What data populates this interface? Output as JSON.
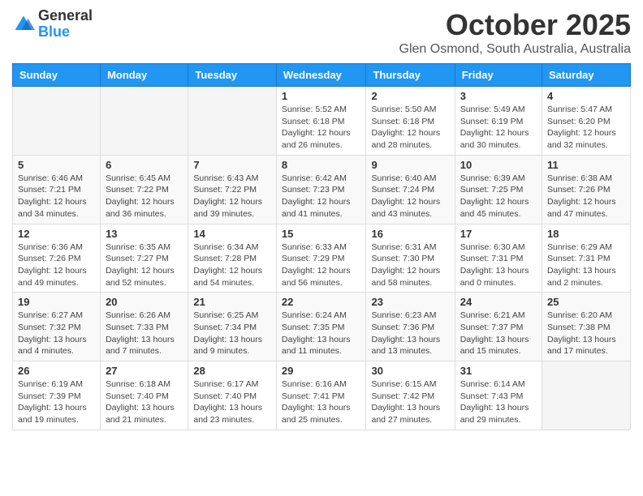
{
  "logo": {
    "general": "General",
    "blue": "Blue"
  },
  "header": {
    "month": "October 2025",
    "location": "Glen Osmond, South Australia, Australia"
  },
  "days_of_week": [
    "Sunday",
    "Monday",
    "Tuesday",
    "Wednesday",
    "Thursday",
    "Friday",
    "Saturday"
  ],
  "weeks": [
    [
      {
        "day": "",
        "info": ""
      },
      {
        "day": "",
        "info": ""
      },
      {
        "day": "",
        "info": ""
      },
      {
        "day": "1",
        "info": "Sunrise: 5:52 AM\nSunset: 6:18 PM\nDaylight: 12 hours\nand 26 minutes."
      },
      {
        "day": "2",
        "info": "Sunrise: 5:50 AM\nSunset: 6:18 PM\nDaylight: 12 hours\nand 28 minutes."
      },
      {
        "day": "3",
        "info": "Sunrise: 5:49 AM\nSunset: 6:19 PM\nDaylight: 12 hours\nand 30 minutes."
      },
      {
        "day": "4",
        "info": "Sunrise: 5:47 AM\nSunset: 6:20 PM\nDaylight: 12 hours\nand 32 minutes."
      }
    ],
    [
      {
        "day": "5",
        "info": "Sunrise: 6:46 AM\nSunset: 7:21 PM\nDaylight: 12 hours\nand 34 minutes."
      },
      {
        "day": "6",
        "info": "Sunrise: 6:45 AM\nSunset: 7:22 PM\nDaylight: 12 hours\nand 36 minutes."
      },
      {
        "day": "7",
        "info": "Sunrise: 6:43 AM\nSunset: 7:22 PM\nDaylight: 12 hours\nand 39 minutes."
      },
      {
        "day": "8",
        "info": "Sunrise: 6:42 AM\nSunset: 7:23 PM\nDaylight: 12 hours\nand 41 minutes."
      },
      {
        "day": "9",
        "info": "Sunrise: 6:40 AM\nSunset: 7:24 PM\nDaylight: 12 hours\nand 43 minutes."
      },
      {
        "day": "10",
        "info": "Sunrise: 6:39 AM\nSunset: 7:25 PM\nDaylight: 12 hours\nand 45 minutes."
      },
      {
        "day": "11",
        "info": "Sunrise: 6:38 AM\nSunset: 7:26 PM\nDaylight: 12 hours\nand 47 minutes."
      }
    ],
    [
      {
        "day": "12",
        "info": "Sunrise: 6:36 AM\nSunset: 7:26 PM\nDaylight: 12 hours\nand 49 minutes."
      },
      {
        "day": "13",
        "info": "Sunrise: 6:35 AM\nSunset: 7:27 PM\nDaylight: 12 hours\nand 52 minutes."
      },
      {
        "day": "14",
        "info": "Sunrise: 6:34 AM\nSunset: 7:28 PM\nDaylight: 12 hours\nand 54 minutes."
      },
      {
        "day": "15",
        "info": "Sunrise: 6:33 AM\nSunset: 7:29 PM\nDaylight: 12 hours\nand 56 minutes."
      },
      {
        "day": "16",
        "info": "Sunrise: 6:31 AM\nSunset: 7:30 PM\nDaylight: 12 hours\nand 58 minutes."
      },
      {
        "day": "17",
        "info": "Sunrise: 6:30 AM\nSunset: 7:31 PM\nDaylight: 13 hours\nand 0 minutes."
      },
      {
        "day": "18",
        "info": "Sunrise: 6:29 AM\nSunset: 7:31 PM\nDaylight: 13 hours\nand 2 minutes."
      }
    ],
    [
      {
        "day": "19",
        "info": "Sunrise: 6:27 AM\nSunset: 7:32 PM\nDaylight: 13 hours\nand 4 minutes."
      },
      {
        "day": "20",
        "info": "Sunrise: 6:26 AM\nSunset: 7:33 PM\nDaylight: 13 hours\nand 7 minutes."
      },
      {
        "day": "21",
        "info": "Sunrise: 6:25 AM\nSunset: 7:34 PM\nDaylight: 13 hours\nand 9 minutes."
      },
      {
        "day": "22",
        "info": "Sunrise: 6:24 AM\nSunset: 7:35 PM\nDaylight: 13 hours\nand 11 minutes."
      },
      {
        "day": "23",
        "info": "Sunrise: 6:23 AM\nSunset: 7:36 PM\nDaylight: 13 hours\nand 13 minutes."
      },
      {
        "day": "24",
        "info": "Sunrise: 6:21 AM\nSunset: 7:37 PM\nDaylight: 13 hours\nand 15 minutes."
      },
      {
        "day": "25",
        "info": "Sunrise: 6:20 AM\nSunset: 7:38 PM\nDaylight: 13 hours\nand 17 minutes."
      }
    ],
    [
      {
        "day": "26",
        "info": "Sunrise: 6:19 AM\nSunset: 7:39 PM\nDaylight: 13 hours\nand 19 minutes."
      },
      {
        "day": "27",
        "info": "Sunrise: 6:18 AM\nSunset: 7:40 PM\nDaylight: 13 hours\nand 21 minutes."
      },
      {
        "day": "28",
        "info": "Sunrise: 6:17 AM\nSunset: 7:40 PM\nDaylight: 13 hours\nand 23 minutes."
      },
      {
        "day": "29",
        "info": "Sunrise: 6:16 AM\nSunset: 7:41 PM\nDaylight: 13 hours\nand 25 minutes."
      },
      {
        "day": "30",
        "info": "Sunrise: 6:15 AM\nSunset: 7:42 PM\nDaylight: 13 hours\nand 27 minutes."
      },
      {
        "day": "31",
        "info": "Sunrise: 6:14 AM\nSunset: 7:43 PM\nDaylight: 13 hours\nand 29 minutes."
      },
      {
        "day": "",
        "info": ""
      }
    ]
  ]
}
